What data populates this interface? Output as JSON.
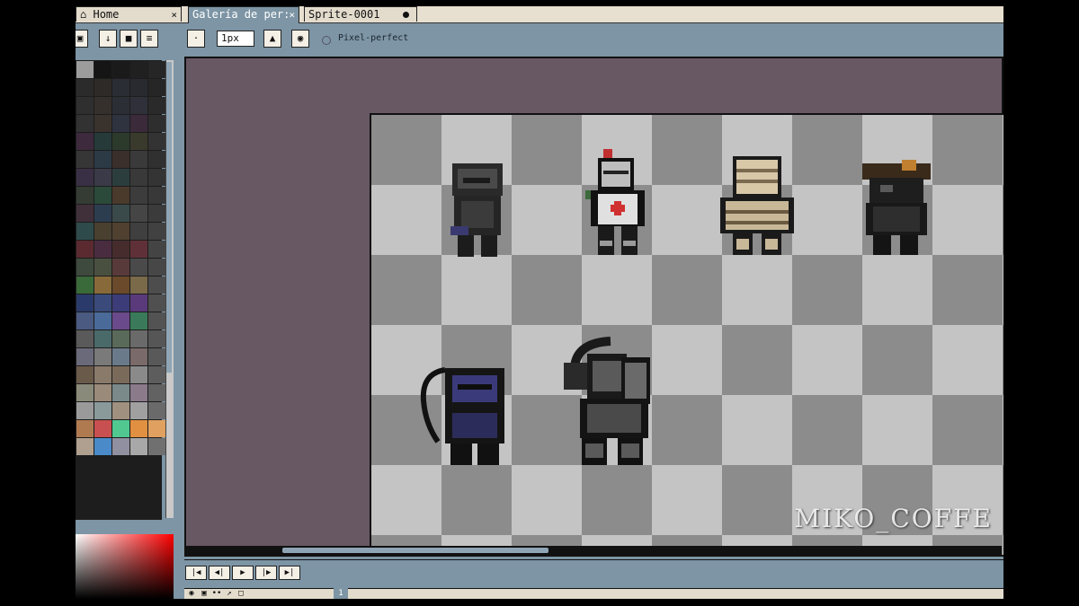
{
  "tabs": [
    {
      "label": "Home",
      "icon": "home-icon",
      "close": "×"
    },
    {
      "label": "Galería de per:",
      "close": "×"
    },
    {
      "label": "Sprite-0001"
    }
  ],
  "toolbar": {
    "brush_size": "1px",
    "pixel_perfect_label": "Pixel-perfect"
  },
  "watermark": "MIKO_COFFE",
  "timeline": {
    "current_frame": "1"
  },
  "colors": {
    "panel": "#7d95a5",
    "canvas_bg": "#685864",
    "checker_light": "#c4c4c4",
    "checker_dark": "#8c8c8c",
    "tab_bg": "#e3dccd"
  },
  "palette": [
    "#9c9c9c",
    "#151515",
    "#1a1a1a",
    "#202020",
    "#262626",
    "#2b2b2b",
    "#2e2a28",
    "#2a2d33",
    "#282a2f",
    "#262626",
    "#2f2f2f",
    "#35302b",
    "#2b2e35",
    "#30303a",
    "#2a2a2a",
    "#323232",
    "#3a332d",
    "#2f3340",
    "#3a2a3a",
    "#2e2e2e",
    "#3d2a3d",
    "#263a3a",
    "#2c3a2c",
    "#3a3a2c",
    "#333333",
    "#363636",
    "#2c3a46",
    "#3a2f2a",
    "#3a3a3a",
    "#303030",
    "#3a3045",
    "#3a3a48",
    "#2c3d3d",
    "#393939",
    "#343434",
    "#343c34",
    "#2b4a3a",
    "#4a3a2c",
    "#3c3c3c",
    "#383838",
    "#40303a",
    "#2d3d50",
    "#3a4a4a",
    "#454545",
    "#3b3b3b",
    "#2f4a4a",
    "#4a4030",
    "#50402f",
    "#3f3f3f",
    "#414141",
    "#5a2a30",
    "#4a2c40",
    "#462c2c",
    "#603038",
    "#444444",
    "#3d4a3d",
    "#4a5040",
    "#583a3a",
    "#4a4a4a",
    "#474747",
    "#3a6a3a",
    "#886a3a",
    "#6a4a2a",
    "#7a6a4a",
    "#4d4d4d",
    "#2a3a6a",
    "#3a4a7a",
    "#3c3c78",
    "#5a3a7a",
    "#505050",
    "#4a5a80",
    "#4a6a9a",
    "#6a4a8a",
    "#3a7a5a",
    "#535353",
    "#5a5a5a",
    "#4a6a6a",
    "#5a6a5a",
    "#6a6a6a",
    "#565656",
    "#6a6a7a",
    "#7a7a7a",
    "#6a7a8a",
    "#7a6a6a",
    "#595959",
    "#6a5a4a",
    "#8a7a6a",
    "#7a6a5a",
    "#8a8a8a",
    "#5d5d5d",
    "#8a8a7a",
    "#9a8a7a",
    "#7a8a8a",
    "#8a7a8a",
    "#626262",
    "#9a9a9a",
    "#8a9a9a",
    "#a09080",
    "#a0a0a0",
    "#6a6a6a",
    "#b07a50",
    "#c85050",
    "#50c890",
    "#e09040",
    "#e0a060",
    "#b0a090",
    "#4a8ac8",
    "#9090a0",
    "#a8a8a8",
    "#707070"
  ]
}
